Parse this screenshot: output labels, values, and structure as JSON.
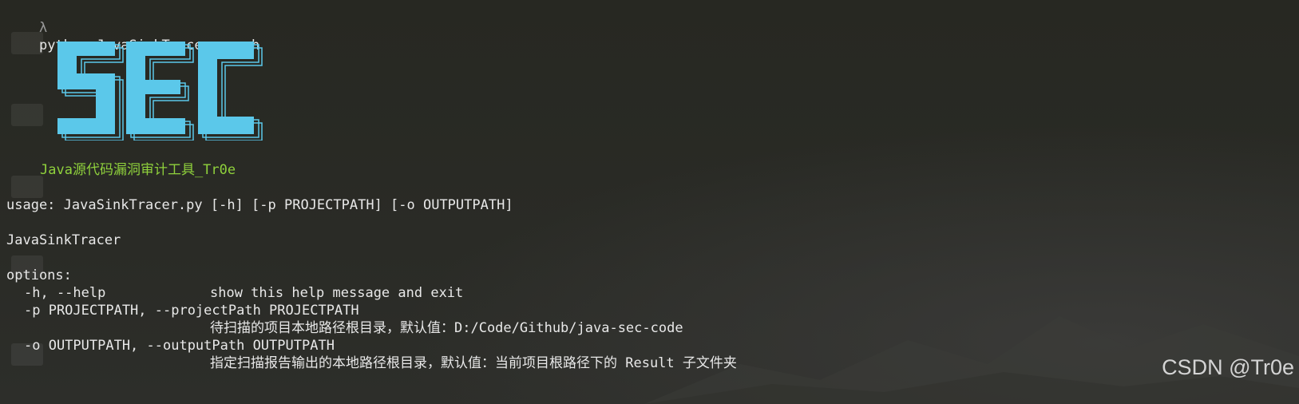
{
  "terminal": {
    "prompt_symbol": "λ",
    "command": "python JavaSinkTracer.py -h",
    "banner_logo_text": "SEC",
    "subtitle": "Java源代码漏洞审计工具_Tr0e",
    "usage": "usage: JavaSinkTracer.py [-h] [-p PROJECTPATH] [-o OUTPUTPATH]",
    "program_name": "JavaSinkTracer",
    "options_header": "options:",
    "options": [
      {
        "flag": "-h, --help",
        "description": "show this help message and exit"
      },
      {
        "flag": "-p PROJECTPATH, --projectPath PROJECTPATH",
        "description": "待扫描的项目本地路径根目录，默认值：D:/Code/Github/java-sec-code"
      },
      {
        "flag": "-o OUTPUTPATH, --outputPath OUTPUTPATH",
        "description": "指定扫描报告输出的本地路径根目录，默认值：当前项目根路径下的 Result 子文件夹"
      }
    ]
  },
  "watermark": "CSDN @Tr0e",
  "colors": {
    "background": "#272822",
    "text": "#e8e8e8",
    "subtitle": "#8fd13c",
    "banner_fill": "#5bc8ea",
    "banner_outline": "#5bc8ea",
    "prompt_symbol": "#9a9a9a"
  }
}
